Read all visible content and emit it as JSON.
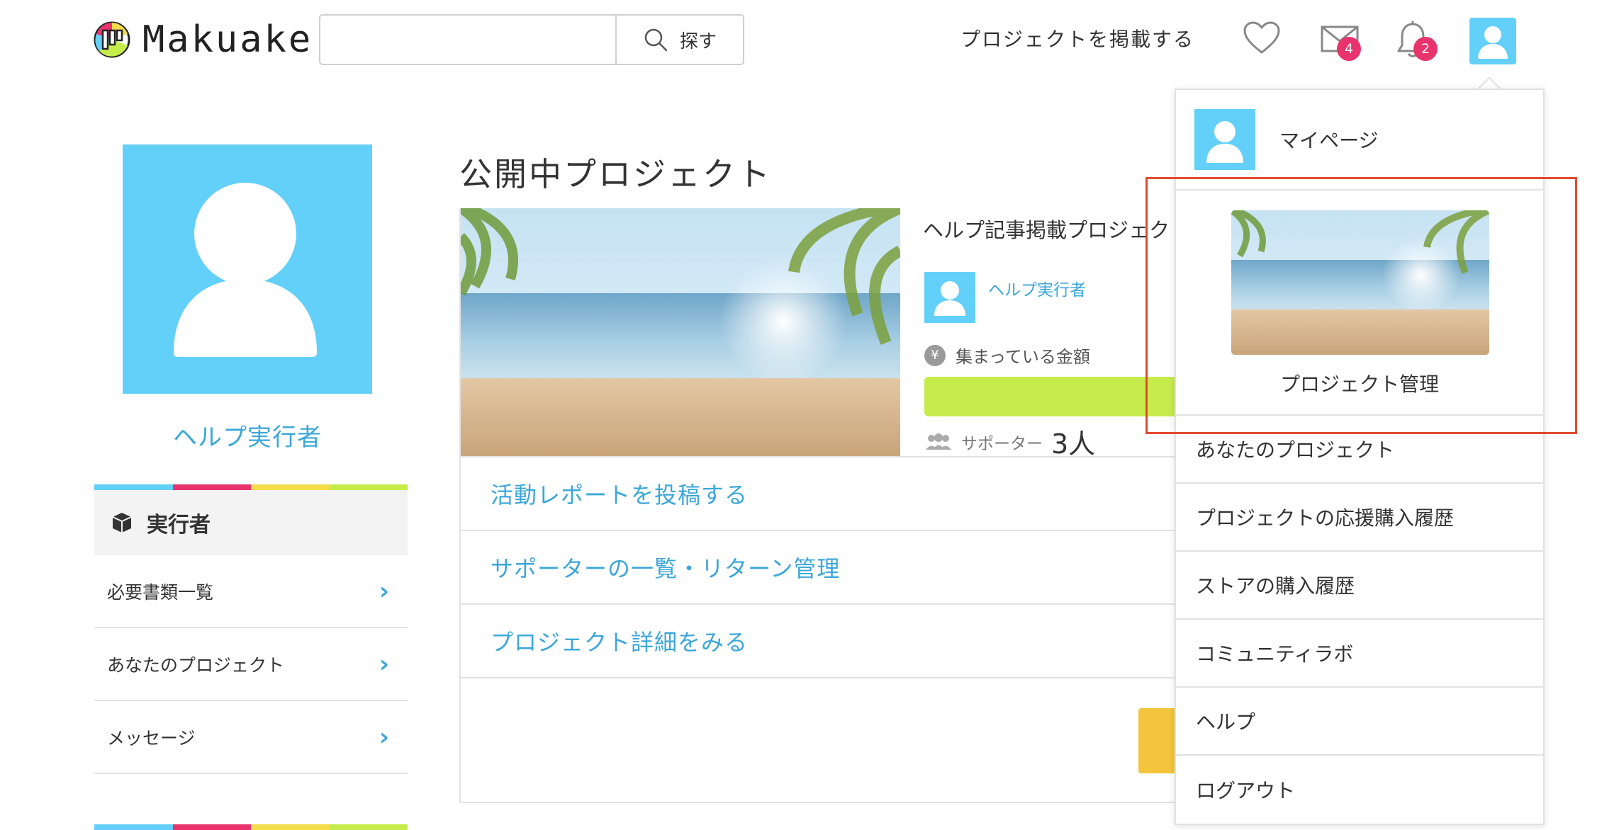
{
  "header": {
    "logo_text": "Makuake",
    "search": {
      "value": "",
      "placeholder": "",
      "button_label": "探す"
    },
    "post_project_label": "プロジェクトを掲載する",
    "mail_badge": "4",
    "notification_badge": "2"
  },
  "sidebar": {
    "user_name": "ヘルプ実行者",
    "section_title": "実行者",
    "items": [
      {
        "label": "必要書類一覧"
      },
      {
        "label": "あなたのプロジェクト"
      },
      {
        "label": "メッセージ"
      }
    ],
    "stripe_colors": [
      "#62d0f9",
      "#e8336d",
      "#f5dc4a",
      "#c6ec4c"
    ]
  },
  "main": {
    "section_title": "公開中プロジェクト",
    "project": {
      "title": "ヘルプ記事掲載プロジェクト",
      "owner": "ヘルプ実行者",
      "money_label": "集まっている金額",
      "supporters_label": "サポーター",
      "supporters_count": "3人"
    },
    "actions": [
      {
        "label": "活動レポートを投稿する"
      },
      {
        "label": "サポーターの一覧・リターン管理"
      },
      {
        "label": "プロジェクト詳細をみる"
      }
    ]
  },
  "dropdown": {
    "mypage_label": "マイページ",
    "project_manage_label": "プロジェクト管理",
    "items": [
      {
        "label": "あなたのプロジェクト"
      },
      {
        "label": "プロジェクトの応援購入履歴"
      },
      {
        "label": "ストアの購入履歴"
      },
      {
        "label": "コミュニティラボ"
      },
      {
        "label": "ヘルプ"
      },
      {
        "label": "ログアウト"
      }
    ]
  },
  "colors": {
    "accent_blue": "#3ba7d9",
    "avatar_blue": "#62d0f9",
    "badge_pink": "#e8336d",
    "progress_green": "#c6ec4c",
    "highlight_red": "#e04a2f"
  }
}
